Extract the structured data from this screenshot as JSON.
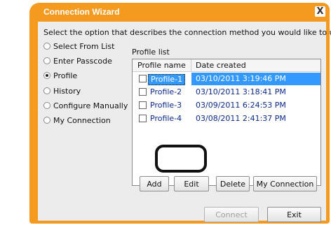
{
  "window": {
    "title": "Connection Wizard",
    "close_glyph": "X"
  },
  "prompt": "Select the option that describes the connection method you would like to use:",
  "options": [
    {
      "label": "Select From List",
      "selected": false
    },
    {
      "label": "Enter Passcode",
      "selected": false
    },
    {
      "label": "Profile",
      "selected": true
    },
    {
      "label": "History",
      "selected": false
    },
    {
      "label": "Configure Manually",
      "selected": false
    },
    {
      "label": "My Connection",
      "selected": false
    }
  ],
  "profile_list": {
    "label": "Profile list",
    "columns": [
      "Profile name",
      "Date created"
    ],
    "rows": [
      {
        "name": "Profile-1",
        "date": "03/10/2011 3:19:46 PM",
        "selected": true
      },
      {
        "name": "Profile-2",
        "date": "03/10/2011 3:18:41 PM",
        "selected": false
      },
      {
        "name": "Profile-3",
        "date": "03/09/2011 6:24:53 PM",
        "selected": false
      },
      {
        "name": "Profile-4",
        "date": "03/08/2011 2:41:37 PM",
        "selected": false
      }
    ]
  },
  "buttons": {
    "add": "Add",
    "edit": "Edit",
    "delete": "Delete",
    "my_connection": "My Connection",
    "connect": "Connect",
    "exit": "Exit"
  },
  "colors": {
    "frame": "#f39a1f",
    "selection": "#3399ff",
    "link_text": "#0b2a8c"
  }
}
